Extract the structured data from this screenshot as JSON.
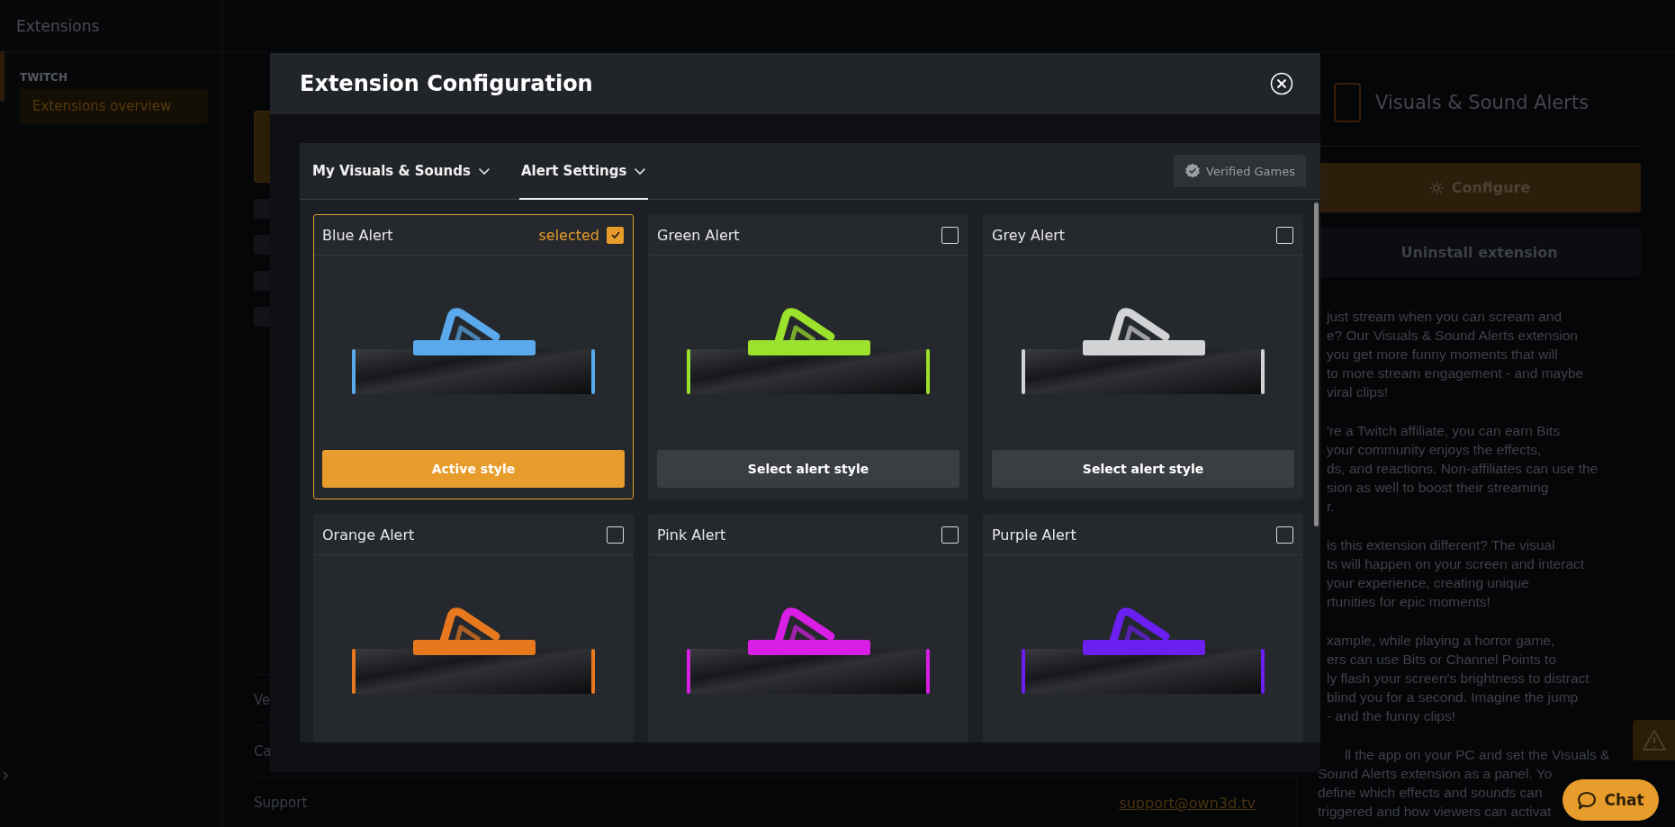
{
  "sidebar": {
    "title": "Extensions",
    "section": "TWITCH",
    "items": [
      {
        "label": "Extensions overview",
        "selected": true
      }
    ]
  },
  "content": {
    "info_rows": [
      {
        "label": "Ve"
      },
      {
        "label": "Ca"
      },
      {
        "label": "Support",
        "value": "support@own3d.tv"
      }
    ]
  },
  "detail": {
    "title": "Visuals & Sound Alerts",
    "configure_button": "Configure",
    "uninstall_button": "Uninstall extension",
    "paragraphs": [
      [
        "just stream when you can scream and",
        "e? Our Visuals & Sound Alerts extension",
        "you get more funny moments that will",
        "to more stream engagement - and maybe",
        "viral clips!"
      ],
      [
        "'re a Twitch affiliate, you can earn Bits",
        "your community enjoys the effects,",
        "ds, and reactions. Non-affiliates can use the",
        "sion as well to boost their streaming",
        "r."
      ],
      [
        "is this extension different? The visual",
        "ts will happen on your screen and interact",
        "your experience, creating unique",
        "rtunities for epic moments!"
      ],
      [
        "xample, while playing a horror game,",
        "ers can use Bits or Channel Points to",
        "ly flash your screen's brightness to distract",
        "blind you for a second. Imagine the jump",
        "- and the funny clips!"
      ],
      [
        "ll the app on your PC and set the Visuals &",
        "Sound Alerts extension as a panel. Yo",
        "define which effects and sounds can",
        "triggered and how viewers can activat"
      ]
    ]
  },
  "modal": {
    "title": "Extension Configuration",
    "tabs": [
      {
        "label": "My Visuals & Sounds",
        "selected": false
      },
      {
        "label": "Alert Settings",
        "selected": true
      }
    ],
    "verified_button": "Verified Games",
    "alerts": [
      {
        "name": "Blue Alert",
        "color": "#5aa9ec",
        "selected": true,
        "selected_label": "selected",
        "button": "Active style"
      },
      {
        "name": "Green Alert",
        "color": "#9be22c",
        "selected": false,
        "button": "Select alert style"
      },
      {
        "name": "Grey Alert",
        "color": "#d2d3d5",
        "selected": false,
        "button": "Select alert style"
      },
      {
        "name": "Orange Alert",
        "color": "#e8781e",
        "selected": false
      },
      {
        "name": "Pink Alert",
        "color": "#d91ee6",
        "selected": false
      },
      {
        "name": "Purple Alert",
        "color": "#6b1ff0",
        "selected": false
      }
    ]
  },
  "chat_button": "Chat"
}
